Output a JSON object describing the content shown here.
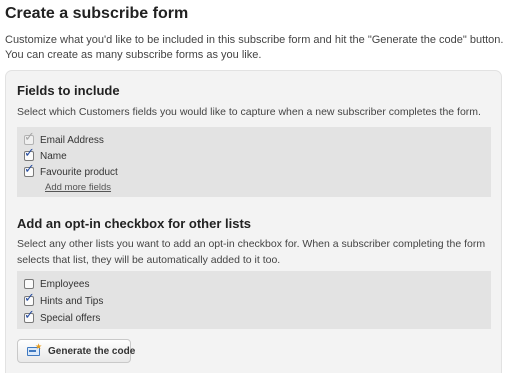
{
  "page": {
    "title": "Create a subscribe form",
    "intro": "Customize what you'd like to be included in this subscribe form and hit the \"Generate the code\" button. You can create as many subscribe forms as you like."
  },
  "fields_section": {
    "title": "Fields to include",
    "description": "Select which Customers fields you would like to capture when a new subscriber completes the form.",
    "items": [
      {
        "label": "Email Address",
        "checked": true,
        "disabled": true
      },
      {
        "label": "Name",
        "checked": true,
        "disabled": false
      },
      {
        "label": "Favourite product",
        "checked": true,
        "disabled": false
      }
    ],
    "add_more_label": "Add more fields"
  },
  "optin_section": {
    "title": "Add an opt-in checkbox for other lists",
    "description": "Select any other lists you want to add an opt-in checkbox for. When a subscriber completing the form selects that list, they will be automatically added to it too.",
    "items": [
      {
        "label": "Employees",
        "checked": false,
        "disabled": false
      },
      {
        "label": "Hints and Tips",
        "checked": true,
        "disabled": false
      },
      {
        "label": "Special offers",
        "checked": true,
        "disabled": false
      }
    ]
  },
  "generate_button": {
    "label": "Generate the code",
    "icon": "code-window-icon"
  },
  "colors": {
    "panel_bg": "#f3f3f3",
    "list_bg": "#e3e3e3",
    "checkmark": "#2a4fa0"
  }
}
